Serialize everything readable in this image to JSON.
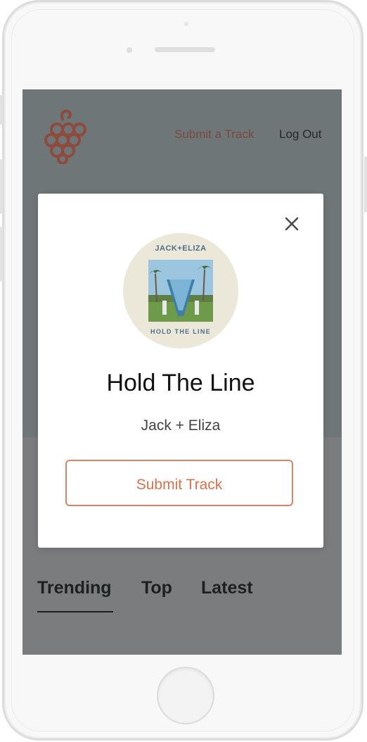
{
  "header": {
    "logo_icon": "grapes-icon",
    "nav_submit": "Submit a Track",
    "nav_logout": "Log Out"
  },
  "tabs": [
    {
      "label": "Trending",
      "active": true
    },
    {
      "label": "Top",
      "active": false
    },
    {
      "label": "Latest",
      "active": false
    }
  ],
  "modal": {
    "close_icon": "close-icon",
    "album_cover": {
      "top_text": "JACK+ELIZA",
      "bottom_text": "HOLD THE LINE"
    },
    "track_title": "Hold The Line",
    "artist": "Jack + Eliza",
    "submit_label": "Submit Track"
  },
  "colors": {
    "accent": "#d9714f",
    "logo": "#8e4a3c",
    "overlay_hero": "#6f7677",
    "overlay_body": "#7b7c7e"
  }
}
